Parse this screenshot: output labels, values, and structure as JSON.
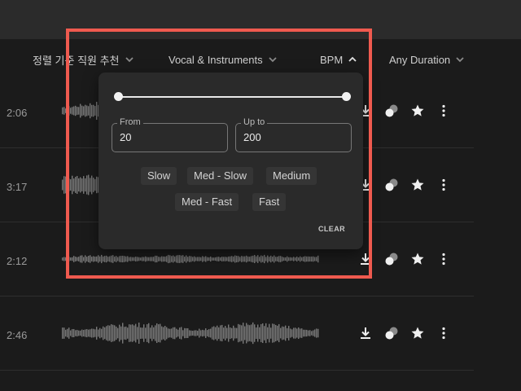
{
  "filters": {
    "sort_label": "정렬 기준 직원 추천",
    "vocal_label": "Vocal & Instruments",
    "bpm_label": "BPM",
    "duration_label": "Any Duration"
  },
  "tracks": [
    {
      "duration": "2:06"
    },
    {
      "duration": "3:17"
    },
    {
      "duration": "2:12"
    },
    {
      "duration": "2:46"
    }
  ],
  "bpm_panel": {
    "slider_min_fraction": 0,
    "slider_max_fraction": 1,
    "from_label": "From",
    "from_value": "20",
    "upto_label": "Up to",
    "upto_value": "200",
    "chips_row1": [
      "Slow",
      "Med - Slow",
      "Medium"
    ],
    "chips_row2": [
      "Med - Fast",
      "Fast"
    ],
    "clear_label": "CLEAR"
  },
  "icons": {
    "download": "download-icon",
    "similar": "similar-icon",
    "favorite": "star-icon",
    "more": "more-vertical-icon"
  },
  "colors": {
    "background": "#1b1b1b",
    "topbar": "#2b2b2b",
    "panel": "#2a2a2a",
    "chip": "#353535",
    "highlight": "#ef5a4f"
  }
}
